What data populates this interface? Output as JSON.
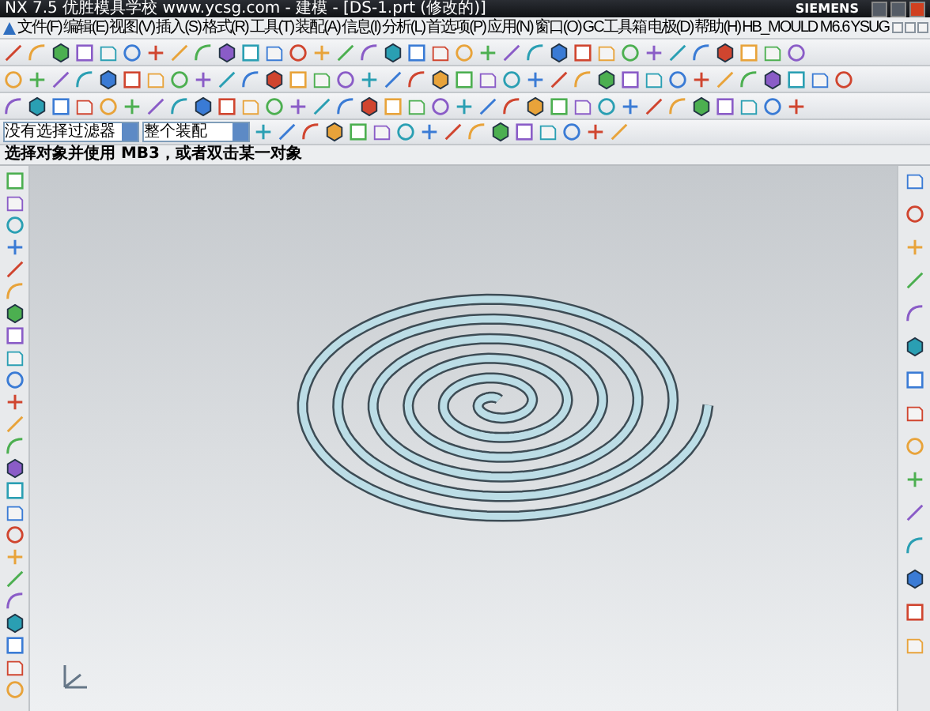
{
  "window": {
    "title": "NX 7.5 优胜模具学校 www.ycsg.com - 建模 - [DS-1.prt (修改的)]",
    "brand": "SIEMENS"
  },
  "menu": [
    "文件(F)",
    "编辑(E)",
    "视图(V)",
    "插入(S)",
    "格式(R)",
    "工具(T)",
    "装配(A)",
    "信息(I)",
    "分析(L)",
    "首选项(P)",
    "应用(N)",
    "窗口(O)",
    "GC工具箱",
    "电极(D)",
    "帮助(H)",
    "HB_MOULD M6.6",
    "YSUG"
  ],
  "selection_bar": {
    "type_filter": "没有选择过滤器",
    "scope": "整个装配"
  },
  "status_line": "选择对象并使用 MB3，或者双击某一对象"
}
